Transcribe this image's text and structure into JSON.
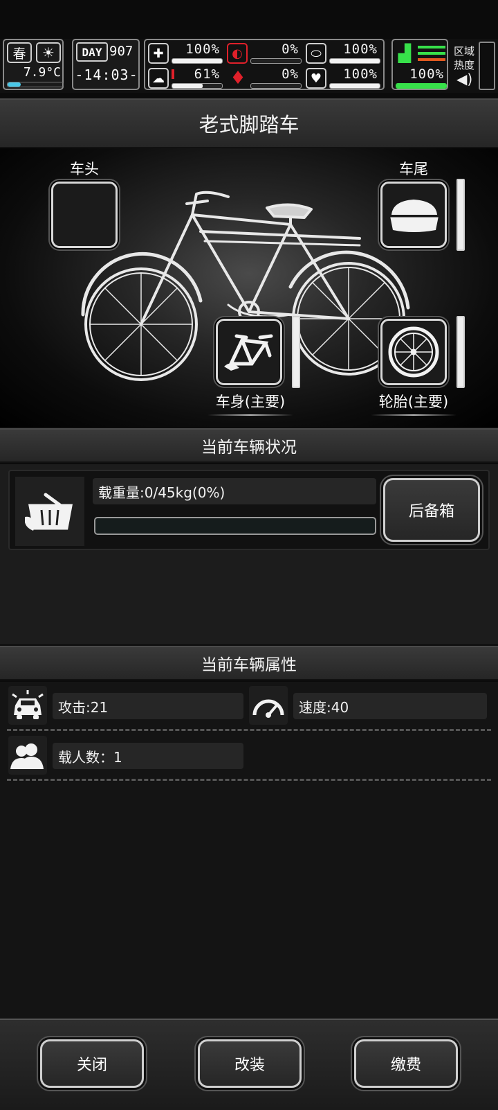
{
  "hud": {
    "season": "春",
    "temperature": "7.9°C",
    "day_label": "DAY",
    "day_value": "907",
    "clock": "-14:03-",
    "stats": [
      {
        "icon": "medkit-icon",
        "value": "100%",
        "level": 1.0
      },
      {
        "icon": "stomach-icon",
        "value": "0%",
        "level": 0.0
      },
      {
        "icon": "pill-icon",
        "value": "100%",
        "level": 1.0
      },
      {
        "icon": "brain-icon",
        "value": "61%",
        "level": 0.61
      },
      {
        "icon": "blood-drop-icon",
        "value": "0%",
        "level": 0.0
      },
      {
        "icon": "heart-icon",
        "value": "100%",
        "level": 1.0
      }
    ],
    "stamina": {
      "icon": "boot-icon",
      "value": "100%",
      "level": 1.0
    },
    "zone_heat_label": "区域\n热度"
  },
  "vehicle": {
    "title": "老式脚踏车",
    "slots": {
      "front": "车头",
      "rear": "车尾",
      "body": "车身(主要)",
      "tire": "轮胎(主要)"
    }
  },
  "status": {
    "header": "当前车辆状况",
    "load_text": "载重量:0/45kg(0%)",
    "load_level": 0.0,
    "trunk_button": "后备箱"
  },
  "attributes": {
    "header": "当前车辆属性",
    "attack": "攻击:21",
    "speed": "速度:40",
    "passengers": "载人数：1"
  },
  "footer": {
    "close": "关闭",
    "modify": "改装",
    "pay": "缴费"
  },
  "colors": {
    "accent_green": "#37e14a",
    "danger_red": "#e0202a",
    "gauge_cyan": "#49c8e8"
  }
}
